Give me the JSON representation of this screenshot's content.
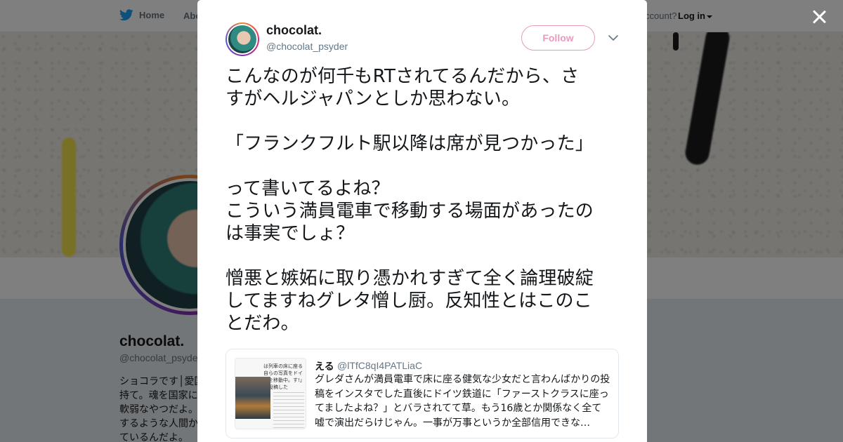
{
  "background_page": {
    "nav": {
      "home_label": "Home",
      "about_label": "Abo",
      "account_prompt": "ccount?",
      "login_label": "Log in"
    },
    "profile": {
      "name": "chocolat.",
      "handle": "@chocolat_psyde",
      "bio_lines": [
        "ショコラです│愛国",
        "持て。魂を国家に",
        "軟弱なやつだよ。",
        "するような人間か",
        "ているんだよ。"
      ]
    }
  },
  "modal": {
    "author": {
      "name": "chocolat.",
      "handle": "@chocolat_psyder"
    },
    "follow_label": "Follow",
    "tweet_lines": [
      "こんなのが何千もRTされてるんだから、さ",
      "すがヘルジャパンとしか思わない。",
      "",
      "「フランクフルト駅以降は席が見つかった」",
      "",
      "って書いてるよね？",
      "こういう満員電車で移動する場面があったの",
      "は事実でしょ？",
      "",
      "憎悪と嫉妬に取り憑かれすぎて全く論理破綻",
      "してますねグレタ憎し厨。反知性とはこのこ",
      "とだわ。"
    ],
    "quoted_tweet": {
      "name": "える",
      "handle": "@lTfC8qI4PATLiaC",
      "text_lines": [
        "グレダさんが満員電車で床に座る健気な少女だと言わんばかりの投",
        "稿をインスタでした直後にドイツ鉄道に「ファーストクラスに座っ",
        "てましたよね？」とバラされてて草。もう16歳とか関係なく全て",
        "嘘で演出だらけじゃん。一事が万事というか全部信用できな…"
      ],
      "image_text": "は列車の床に座る自らの写真をドイツを移動中。す!」と投稿した"
    }
  },
  "colors": {
    "follow_accent": "#e89bbd",
    "twitter_blue": "#1da1f2",
    "overlay": "rgba(0,0,0,0.5)"
  },
  "icons": {
    "close": "close-icon",
    "twitter": "twitter-bird-icon",
    "chevron": "chevron-down-icon"
  }
}
